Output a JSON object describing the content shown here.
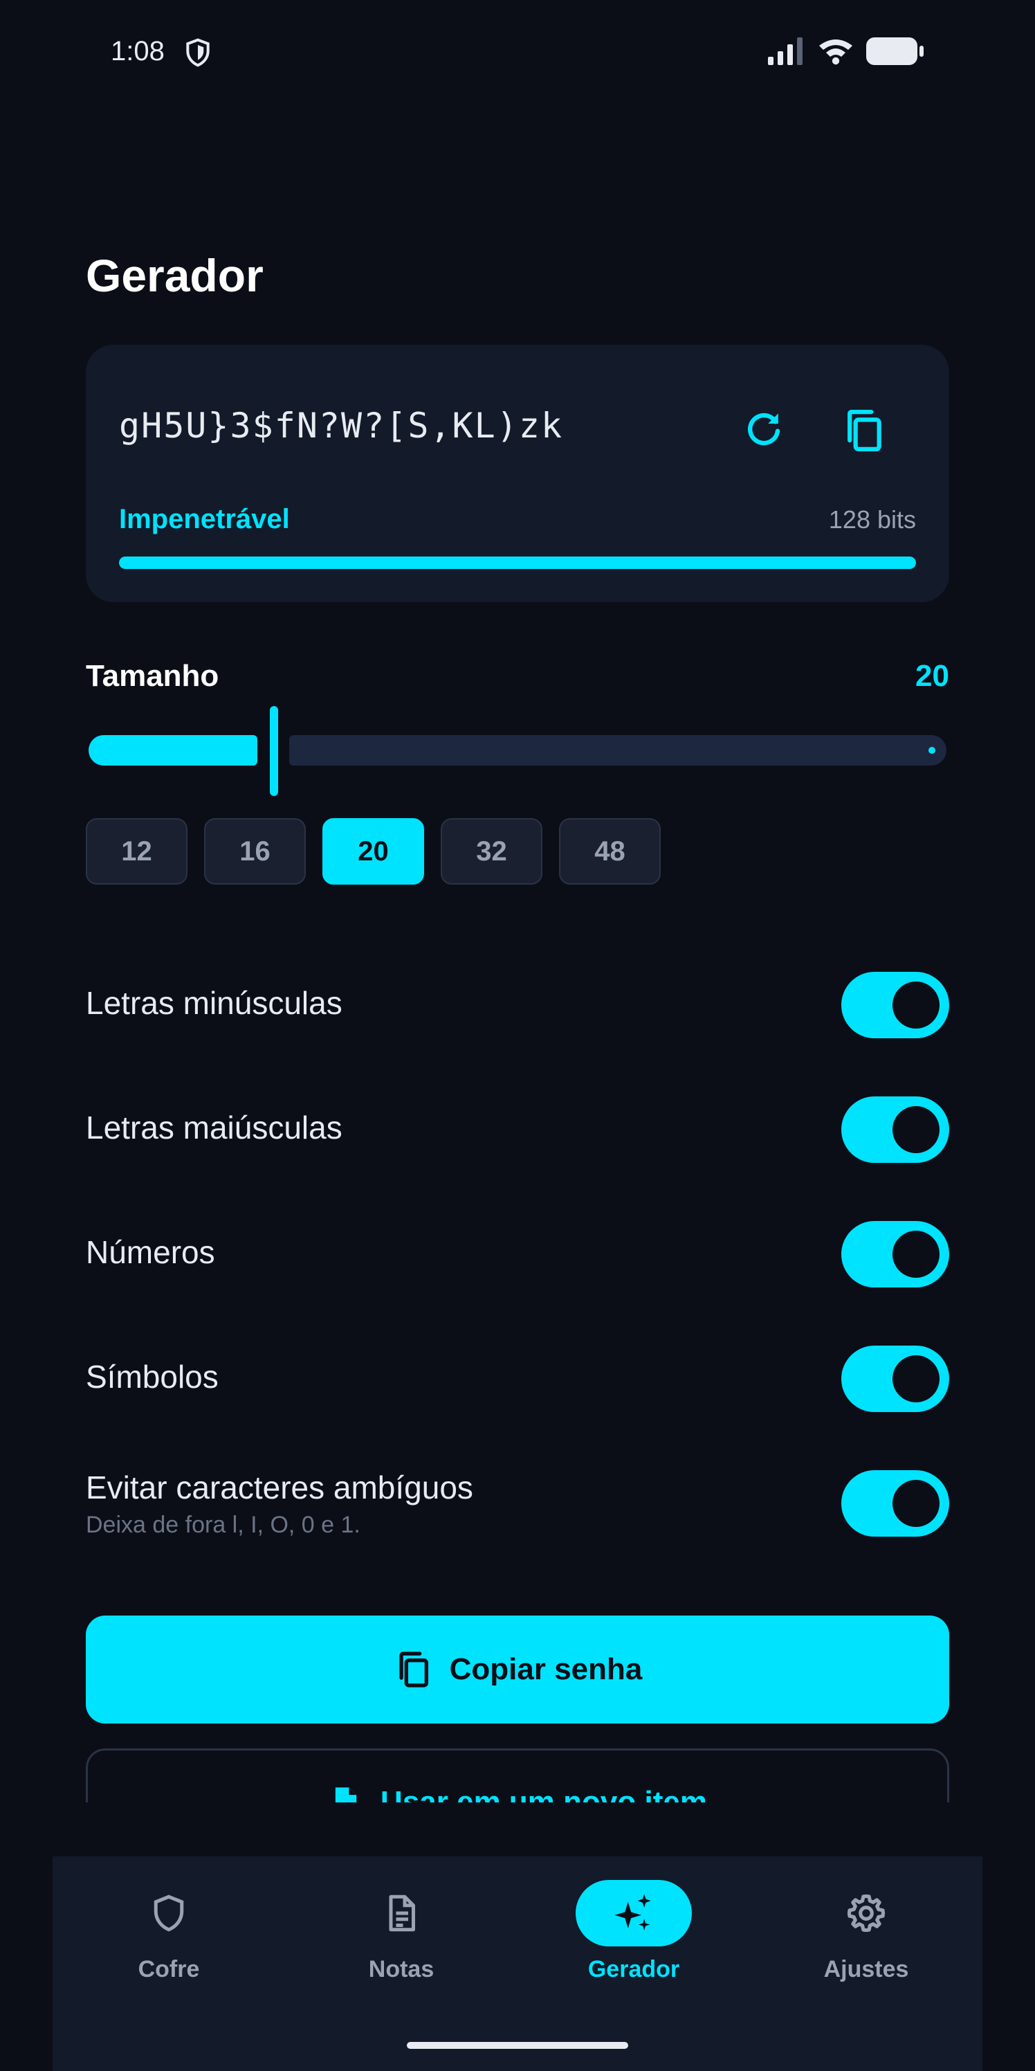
{
  "status_bar": {
    "time": "1:08"
  },
  "page_title": "Gerador",
  "password": {
    "value": "gH5U}3$fN?W?[S,KL)zk",
    "strength_label": "Impenetrável",
    "entropy": "128 bits",
    "strength_fraction": 1.0
  },
  "size": {
    "label": "Tamanho",
    "value": "20",
    "presets": [
      "12",
      "16",
      "20",
      "32",
      "48"
    ],
    "selected_preset": "20"
  },
  "options": [
    {
      "label": "Letras minúsculas",
      "enabled": true
    },
    {
      "label": "Letras maiúsculas",
      "enabled": true
    },
    {
      "label": "Números",
      "enabled": true
    },
    {
      "label": "Símbolos",
      "enabled": true
    },
    {
      "label": "Evitar caracteres ambíguos",
      "sublabel": "Deixa de fora l, I, O, 0 e 1.",
      "enabled": true
    }
  ],
  "actions": {
    "copy_label": "Copiar senha",
    "new_item_label": "Usar em um novo item"
  },
  "nav": {
    "items": [
      {
        "label": "Cofre",
        "icon": "shield-icon"
      },
      {
        "label": "Notas",
        "icon": "document-icon"
      },
      {
        "label": "Gerador",
        "icon": "sparkles-icon",
        "active": true
      },
      {
        "label": "Ajustes",
        "icon": "gear-icon"
      }
    ]
  },
  "colors": {
    "accent": "#00e3ff",
    "background": "#0b0e17",
    "card": "#131a29"
  }
}
